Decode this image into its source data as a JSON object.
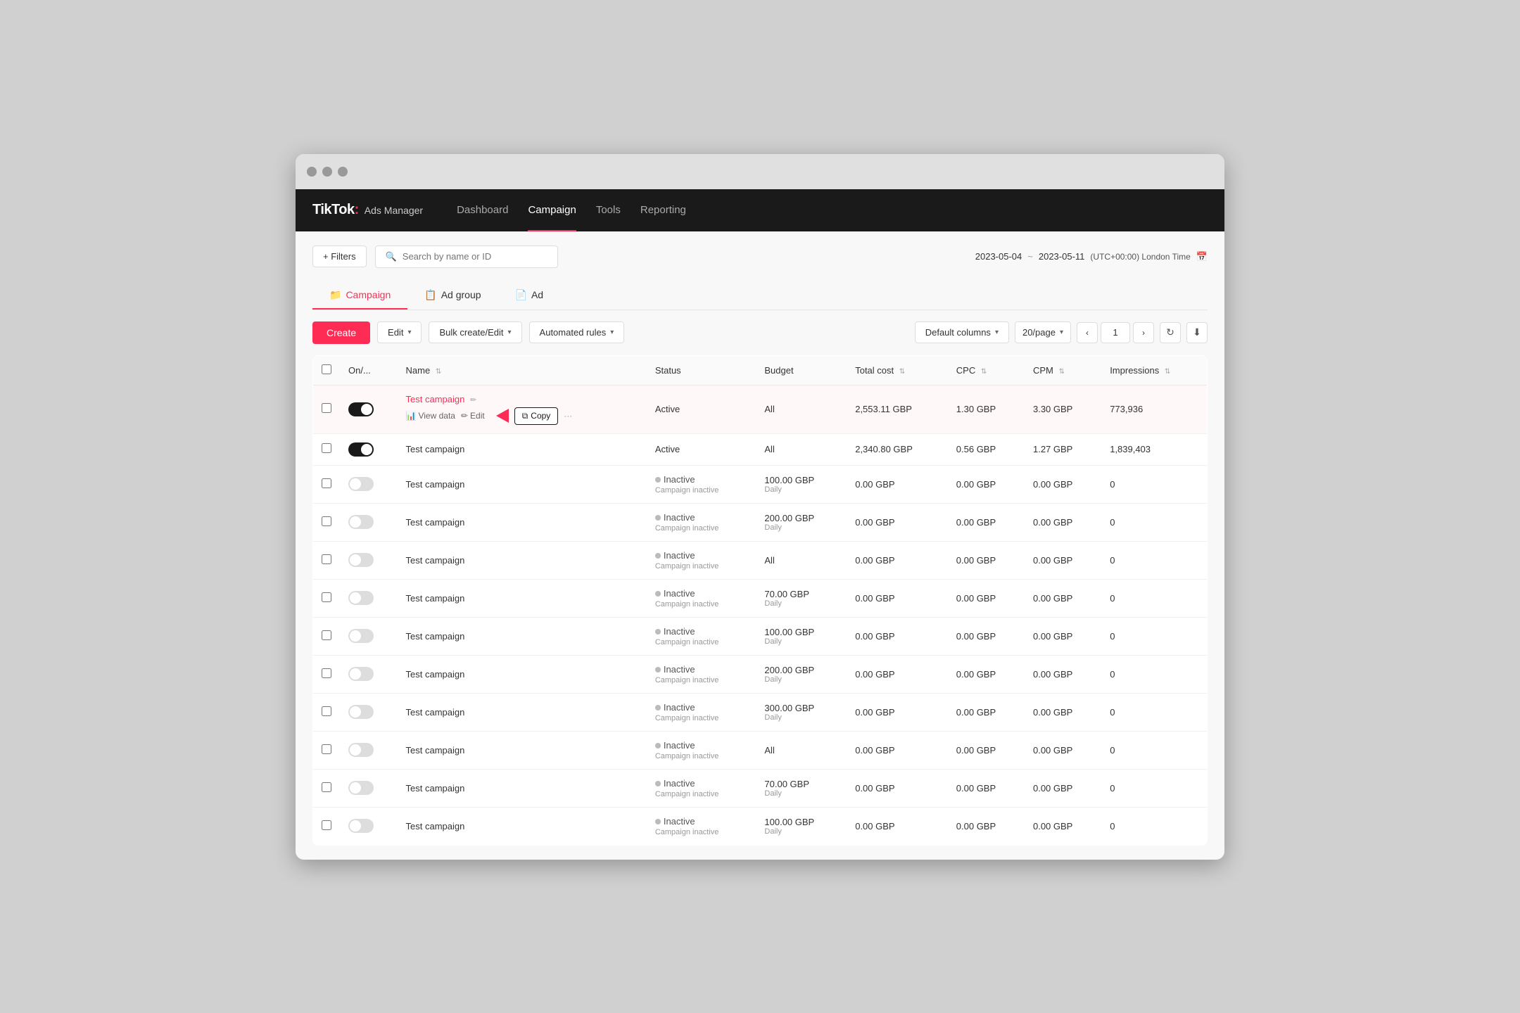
{
  "window": {
    "title": "TikTok Ads Manager"
  },
  "brand": {
    "name": "TikTok",
    "colon": ":",
    "sub": "Ads Manager"
  },
  "nav": {
    "items": [
      {
        "label": "Dashboard",
        "active": false
      },
      {
        "label": "Campaign",
        "active": true
      },
      {
        "label": "Tools",
        "active": false
      },
      {
        "label": "Reporting",
        "active": false
      }
    ]
  },
  "toolbar": {
    "filters_label": "+ Filters",
    "search_placeholder": "Search by name or ID",
    "date_start": "2023-05-04",
    "date_tilde": "~",
    "date_end": "2023-05-11",
    "timezone": "(UTC+00:00) London Time",
    "cal_icon": "📅"
  },
  "tabs": [
    {
      "label": "Campaign",
      "icon": "📁",
      "active": true
    },
    {
      "label": "Ad group",
      "icon": "📋",
      "active": false
    },
    {
      "label": "Ad",
      "icon": "📄",
      "active": false
    }
  ],
  "actions": {
    "create_label": "Create",
    "edit_label": "Edit",
    "bulk_label": "Bulk create/Edit",
    "auto_rules_label": "Automated rules",
    "default_cols_label": "Default columns",
    "per_page_label": "20/page",
    "page_num": "1",
    "refresh_icon": "↻",
    "export_icon": "⬇"
  },
  "table": {
    "columns": [
      {
        "label": "On/...",
        "sortable": false
      },
      {
        "label": "Name",
        "sortable": true
      },
      {
        "label": "Status",
        "sortable": false
      },
      {
        "label": "Budget",
        "sortable": false
      },
      {
        "label": "Total cost",
        "sortable": true
      },
      {
        "label": "CPC",
        "sortable": true
      },
      {
        "label": "CPM",
        "sortable": true
      },
      {
        "label": "Impressions",
        "sortable": true
      }
    ],
    "rows": [
      {
        "id": 1,
        "toggle": "on",
        "name": "Test campaign",
        "name_link": true,
        "show_actions": true,
        "show_copy": true,
        "highlighted": true,
        "status": "Active",
        "status_type": "active",
        "budget": "All",
        "budget_sub": "",
        "total_cost": "2,553.11 GBP",
        "cpc": "1.30 GBP",
        "cpm": "3.30 GBP",
        "impressions": "773,936"
      },
      {
        "id": 2,
        "toggle": "on",
        "name": "Test campaign",
        "name_link": false,
        "show_actions": false,
        "show_copy": false,
        "highlighted": false,
        "status": "Active",
        "status_type": "active",
        "budget": "All",
        "budget_sub": "",
        "total_cost": "2,340.80 GBP",
        "cpc": "0.56 GBP",
        "cpm": "1.27 GBP",
        "impressions": "1,839,403"
      },
      {
        "id": 3,
        "toggle": "off",
        "name": "Test campaign",
        "name_link": false,
        "show_actions": false,
        "show_copy": false,
        "highlighted": false,
        "status": "Inactive",
        "status_type": "inactive",
        "status_sub": "Campaign inactive",
        "budget": "100.00 GBP",
        "budget_sub": "Daily",
        "total_cost": "0.00 GBP",
        "cpc": "0.00 GBP",
        "cpm": "0.00 GBP",
        "impressions": "0"
      },
      {
        "id": 4,
        "toggle": "off",
        "name": "Test campaign",
        "name_link": false,
        "show_actions": false,
        "show_copy": false,
        "highlighted": false,
        "status": "Inactive",
        "status_type": "inactive",
        "status_sub": "Campaign inactive",
        "budget": "200.00 GBP",
        "budget_sub": "Daily",
        "total_cost": "0.00 GBP",
        "cpc": "0.00 GBP",
        "cpm": "0.00 GBP",
        "impressions": "0"
      },
      {
        "id": 5,
        "toggle": "off",
        "name": "Test campaign",
        "name_link": false,
        "show_actions": false,
        "show_copy": false,
        "highlighted": false,
        "status": "Inactive",
        "status_type": "inactive",
        "status_sub": "Campaign inactive",
        "budget": "All",
        "budget_sub": "",
        "total_cost": "0.00 GBP",
        "cpc": "0.00 GBP",
        "cpm": "0.00 GBP",
        "impressions": "0"
      },
      {
        "id": 6,
        "toggle": "off",
        "name": "Test campaign",
        "name_link": false,
        "show_actions": false,
        "show_copy": false,
        "highlighted": false,
        "status": "Inactive",
        "status_type": "inactive",
        "status_sub": "Campaign inactive",
        "budget": "70.00 GBP",
        "budget_sub": "Daily",
        "total_cost": "0.00 GBP",
        "cpc": "0.00 GBP",
        "cpm": "0.00 GBP",
        "impressions": "0"
      },
      {
        "id": 7,
        "toggle": "off",
        "name": "Test campaign",
        "name_link": false,
        "show_actions": false,
        "show_copy": false,
        "highlighted": false,
        "status": "Inactive",
        "status_type": "inactive",
        "status_sub": "Campaign inactive",
        "budget": "100.00 GBP",
        "budget_sub": "Daily",
        "total_cost": "0.00 GBP",
        "cpc": "0.00 GBP",
        "cpm": "0.00 GBP",
        "impressions": "0"
      },
      {
        "id": 8,
        "toggle": "off",
        "name": "Test campaign",
        "name_link": false,
        "show_actions": false,
        "show_copy": false,
        "highlighted": false,
        "status": "Inactive",
        "status_type": "inactive",
        "status_sub": "Campaign inactive",
        "budget": "200.00 GBP",
        "budget_sub": "Daily",
        "total_cost": "0.00 GBP",
        "cpc": "0.00 GBP",
        "cpm": "0.00 GBP",
        "impressions": "0"
      },
      {
        "id": 9,
        "toggle": "off",
        "name": "Test campaign",
        "name_link": false,
        "show_actions": false,
        "show_copy": false,
        "highlighted": false,
        "status": "Inactive",
        "status_type": "inactive",
        "status_sub": "Campaign inactive",
        "budget": "300.00 GBP",
        "budget_sub": "Daily",
        "total_cost": "0.00 GBP",
        "cpc": "0.00 GBP",
        "cpm": "0.00 GBP",
        "impressions": "0"
      },
      {
        "id": 10,
        "toggle": "off",
        "name": "Test campaign",
        "name_link": false,
        "show_actions": false,
        "show_copy": false,
        "highlighted": false,
        "status": "Inactive",
        "status_type": "inactive",
        "status_sub": "Campaign inactive",
        "budget": "All",
        "budget_sub": "",
        "total_cost": "0.00 GBP",
        "cpc": "0.00 GBP",
        "cpm": "0.00 GBP",
        "impressions": "0"
      },
      {
        "id": 11,
        "toggle": "off",
        "name": "Test campaign",
        "name_link": false,
        "show_actions": false,
        "show_copy": false,
        "highlighted": false,
        "status": "Inactive",
        "status_type": "inactive",
        "status_sub": "Campaign inactive",
        "budget": "70.00 GBP",
        "budget_sub": "Daily",
        "total_cost": "0.00 GBP",
        "cpc": "0.00 GBP",
        "cpm": "0.00 GBP",
        "impressions": "0"
      },
      {
        "id": 12,
        "toggle": "off",
        "name": "Test campaign",
        "name_link": false,
        "show_actions": false,
        "show_copy": false,
        "highlighted": false,
        "status": "Inactive",
        "status_type": "inactive",
        "status_sub": "Campaign inactive",
        "budget": "100.00 GBP",
        "budget_sub": "Daily",
        "total_cost": "0.00 GBP",
        "cpc": "0.00 GBP",
        "cpm": "0.00 GBP",
        "impressions": "0"
      }
    ]
  }
}
